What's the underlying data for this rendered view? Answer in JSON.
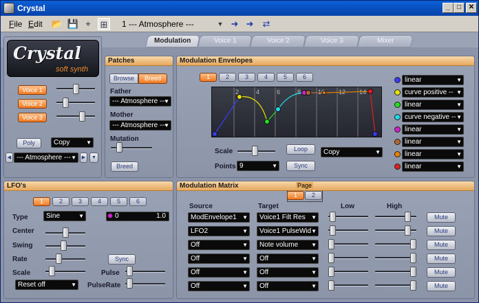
{
  "window": {
    "title": "Crystal"
  },
  "menu": {
    "file": "File",
    "edit": "Edit",
    "file_key": "F",
    "file_rest": "ile",
    "edit_key": "E",
    "edit_rest": "dit"
  },
  "toolbar": {
    "preset_name": "1 --- Atmosphere ---"
  },
  "tabs": [
    "Modulation",
    "Voice 1",
    "Voice 2",
    "Voice 3",
    "Mixer"
  ],
  "logo": {
    "title": "Crystal",
    "subtitle": "soft synth"
  },
  "voices": [
    "Voice 1",
    "Voice 2",
    "Voice 3"
  ],
  "voice_levels": [
    0.5,
    0.2,
    0.7
  ],
  "poly": {
    "label": "Poly",
    "mode": "Copy"
  },
  "preset": {
    "value": "--- Atmosphere ---"
  },
  "patches": {
    "title": "Patches",
    "browse": "Browse",
    "breed": "Breed",
    "father_label": "Father",
    "father_value": "--- Atmosphere ---",
    "mother_label": "Mother",
    "mother_value": "--- Atmosphere ---",
    "mutation_label": "Mutation",
    "mutation_level": 0.15,
    "breed_button": "Breed"
  },
  "envelopes": {
    "title": "Modulation Envelopes",
    "pages": [
      "1",
      "2",
      "3",
      "4",
      "5",
      "6"
    ],
    "active_page": 0,
    "grid_labels": [
      "2",
      "4",
      "6",
      "8",
      "10",
      "12",
      "14"
    ],
    "scale_label": "Scale",
    "scale_level": 0.45,
    "loop": "Loop",
    "copy": "Copy",
    "points_label": "Points",
    "points_value": "9",
    "sync": "Sync",
    "curves": [
      {
        "color": "#3a3aff",
        "value": "linear"
      },
      {
        "color": "#e8e000",
        "value": "curve positive --"
      },
      {
        "color": "#20e020",
        "value": "linear"
      },
      {
        "color": "#20d8e8",
        "value": "curve negative --"
      },
      {
        "color": "#d020d0",
        "value": "linear"
      },
      {
        "color": "#b06a30",
        "value": "linear"
      },
      {
        "color": "#e88000",
        "value": "linear"
      },
      {
        "color": "#e02020",
        "value": "linear"
      }
    ]
  },
  "lfos": {
    "title": "LFO's",
    "pages": [
      "1",
      "2",
      "3",
      "4",
      "5",
      "6"
    ],
    "active_page": 0,
    "type_label": "Type",
    "type_value": "Sine",
    "range_min": "0",
    "range_max": "1.0",
    "center_label": "Center",
    "center_level": 0.5,
    "swing_label": "Swing",
    "swing_level": 0.45,
    "rate_label": "Rate",
    "rate_level": 0.3,
    "sync": "Sync",
    "scale_label": "Scale",
    "scale_level": 0.1,
    "pulse_label": "Pulse",
    "pulse_level": 0.05,
    "pulserate_label": "PulseRate",
    "pulserate_level": 0.05,
    "reset_value": "Reset off"
  },
  "matrix": {
    "title": "Modulation Matrix",
    "page_label": "Page",
    "pages": [
      "1",
      "2"
    ],
    "active_page": 0,
    "source_header": "Source",
    "target_header": "Target",
    "low_header": "Low",
    "high_header": "High",
    "rows": [
      {
        "source": "ModEnvelope1",
        "target": "Voice1 Filt Res",
        "low": 0.05,
        "high": 0.85,
        "mute": "Mute"
      },
      {
        "source": "LFO2",
        "target": "Voice1 PulseWid",
        "low": 0.05,
        "high": 0.85,
        "mute": "Mute"
      },
      {
        "source": "Off",
        "target": "Note volume",
        "low": 0.0,
        "high": 1.0,
        "mute": "Mute"
      },
      {
        "source": "Off",
        "target": "Off",
        "low": 0.0,
        "high": 1.0,
        "mute": "Mute"
      },
      {
        "source": "Off",
        "target": "Off",
        "low": 0.0,
        "high": 1.0,
        "mute": "Mute"
      },
      {
        "source": "Off",
        "target": "Off",
        "low": 0.0,
        "high": 1.0,
        "mute": "Mute"
      }
    ]
  }
}
